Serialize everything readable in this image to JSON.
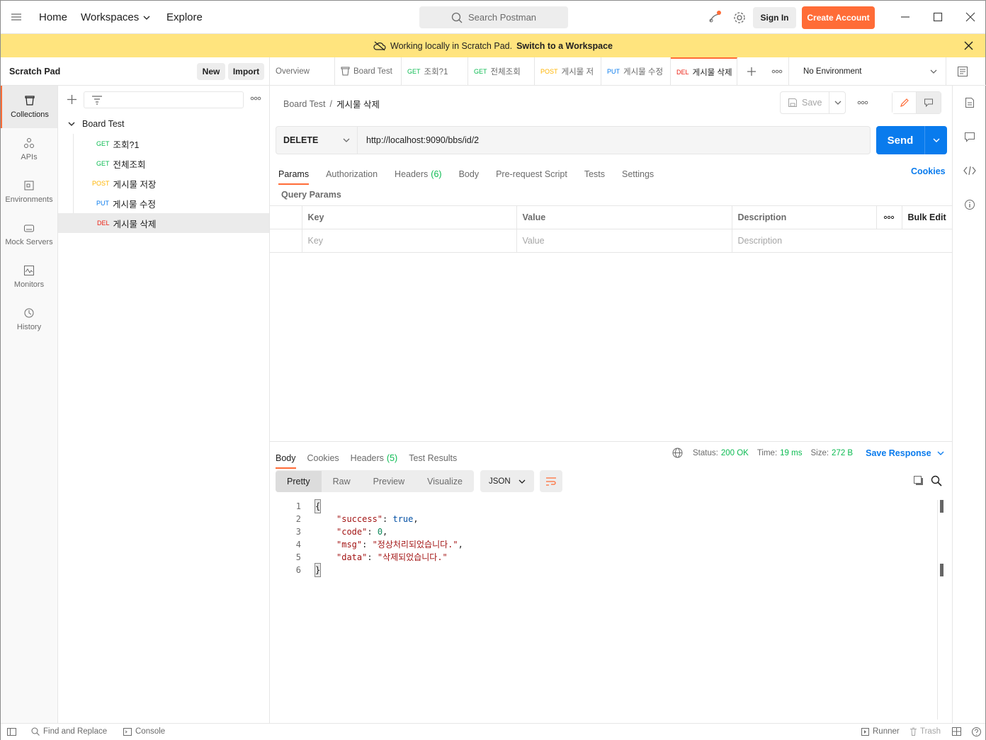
{
  "topbar": {
    "home": "Home",
    "workspaces": "Workspaces",
    "explore": "Explore",
    "search_placeholder": "Search Postman",
    "sign_in": "Sign In",
    "create_account": "Create Account"
  },
  "banner": {
    "text": "Working locally in Scratch Pad.",
    "link": "Switch to a Workspace"
  },
  "sidebar": {
    "title": "Scratch Pad",
    "new_label": "New",
    "import_label": "Import",
    "rail": [
      {
        "label": "Collections",
        "icon": "collections-icon"
      },
      {
        "label": "APIs",
        "icon": "apis-icon"
      },
      {
        "label": "Environments",
        "icon": "environments-icon"
      },
      {
        "label": "Mock Servers",
        "icon": "mock-servers-icon"
      },
      {
        "label": "Monitors",
        "icon": "monitors-icon"
      },
      {
        "label": "History",
        "icon": "history-icon"
      }
    ],
    "collection": "Board Test",
    "requests": [
      {
        "method": "GET",
        "name": "조회?1"
      },
      {
        "method": "GET",
        "name": "전체조회"
      },
      {
        "method": "POST",
        "name": "게시물 저장"
      },
      {
        "method": "PUT",
        "name": "게시물 수정"
      },
      {
        "method": "DEL",
        "name": "게시물 삭제"
      }
    ]
  },
  "tabs": [
    {
      "label": "Overview",
      "method": ""
    },
    {
      "label": "Board Test",
      "method": ""
    },
    {
      "label": "조회?1",
      "method": "GET"
    },
    {
      "label": "전체조회",
      "method": "GET"
    },
    {
      "label": "게시물 저",
      "method": "POST"
    },
    {
      "label": "게시물 수정",
      "method": "PUT"
    },
    {
      "label": "게시물 삭제",
      "method": "DEL"
    }
  ],
  "environment": "No Environment",
  "request": {
    "breadcrumb_collection": "Board Test",
    "breadcrumb_separator": "/",
    "breadcrumb_name": "게시물 삭제",
    "save_label": "Save",
    "method": "DELETE",
    "url": "http://localhost:9090/bbs/id/2",
    "send_label": "Send",
    "subtabs": [
      "Params",
      "Authorization",
      "Headers",
      "Body",
      "Pre-request Script",
      "Tests",
      "Settings"
    ],
    "headers_count": "(6)",
    "cookies_label": "Cookies",
    "query_params_title": "Query Params",
    "columns": [
      "Key",
      "Value",
      "Description"
    ],
    "bulk_edit": "Bulk Edit",
    "placeholders": [
      "Key",
      "Value",
      "Description"
    ]
  },
  "response": {
    "tabs": [
      "Body",
      "Cookies",
      "Headers",
      "Test Results"
    ],
    "headers_count": "(5)",
    "status_label": "Status:",
    "status_value": "200 OK",
    "time_label": "Time:",
    "time_value": "19 ms",
    "size_label": "Size:",
    "size_value": "272 B",
    "save_response": "Save Response",
    "view_modes": [
      "Pretty",
      "Raw",
      "Preview",
      "Visualize"
    ],
    "format": "JSON",
    "lines": [
      {
        "n": "1",
        "text": "{"
      },
      {
        "n": "2",
        "key": "\"success\"",
        "val": "true",
        "type": "b",
        "comma": ","
      },
      {
        "n": "3",
        "key": "\"code\"",
        "val": "0",
        "type": "n",
        "comma": ","
      },
      {
        "n": "4",
        "key": "\"msg\"",
        "val": "\"정상처리되었습니다.\"",
        "type": "s",
        "comma": ","
      },
      {
        "n": "5",
        "key": "\"data\"",
        "val": "\"삭제되었습니다.\"",
        "type": "s",
        "comma": ""
      },
      {
        "n": "6",
        "text": "}"
      }
    ]
  },
  "statusbar": {
    "find_replace": "Find and Replace",
    "console": "Console",
    "runner": "Runner",
    "trash": "Trash"
  },
  "colors": {
    "accent": "#ff6c37",
    "send": "#097bed",
    "banner": "#ffe47e",
    "status_ok": "#0cbb52"
  }
}
